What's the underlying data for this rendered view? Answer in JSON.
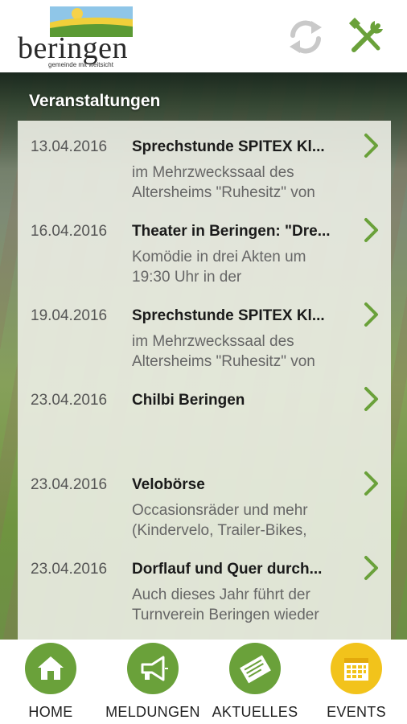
{
  "header": {
    "logo": {
      "name": "beringen",
      "tagline": "gemeinde mit weitsicht"
    },
    "icons": [
      "refresh-icon",
      "tools-icon"
    ]
  },
  "section_title": "Veranstaltungen",
  "events": [
    {
      "date": "13.04.2016",
      "title": "Sprechstunde SPITEX Kl...",
      "desc1": "im Mehrzweckssaal des",
      "desc2": "Altersheims \"Ruhesitz\" von"
    },
    {
      "date": "16.04.2016",
      "title": "Theater in Beringen: \"Dre...",
      "desc1": "Komödie in drei Akten um",
      "desc2": "19:30 Uhr in der"
    },
    {
      "date": "19.04.2016",
      "title": "Sprechstunde SPITEX Kl...",
      "desc1": "im Mehrzweckssaal des",
      "desc2": "Altersheims \"Ruhesitz\" von"
    },
    {
      "date": "23.04.2016",
      "title": "Chilbi Beringen",
      "desc1": "",
      "desc2": ""
    },
    {
      "date": "23.04.2016",
      "title": "Velobörse",
      "desc1": "Occasionsräder und mehr",
      "desc2": "(Kindervelo, Trailer-Bikes,"
    },
    {
      "date": "23.04.2016",
      "title": "Dorflauf und Quer durch...",
      "desc1": "Auch dieses Jahr führt der",
      "desc2": "Turnverein Beringen wieder"
    }
  ],
  "tabs": [
    {
      "label": "HOME",
      "icon": "home-icon",
      "color": "#6aa13a"
    },
    {
      "label": "MELDUNGEN",
      "icon": "megaphone-icon",
      "color": "#6aa13a"
    },
    {
      "label": "AKTUELLES",
      "icon": "newspaper-icon",
      "color": "#6aa13a"
    },
    {
      "label": "EVENTS",
      "icon": "calendar-icon",
      "color": "#f2c31b"
    }
  ],
  "colors": {
    "accent_green": "#6aa13a",
    "accent_yellow": "#f2c31b"
  }
}
